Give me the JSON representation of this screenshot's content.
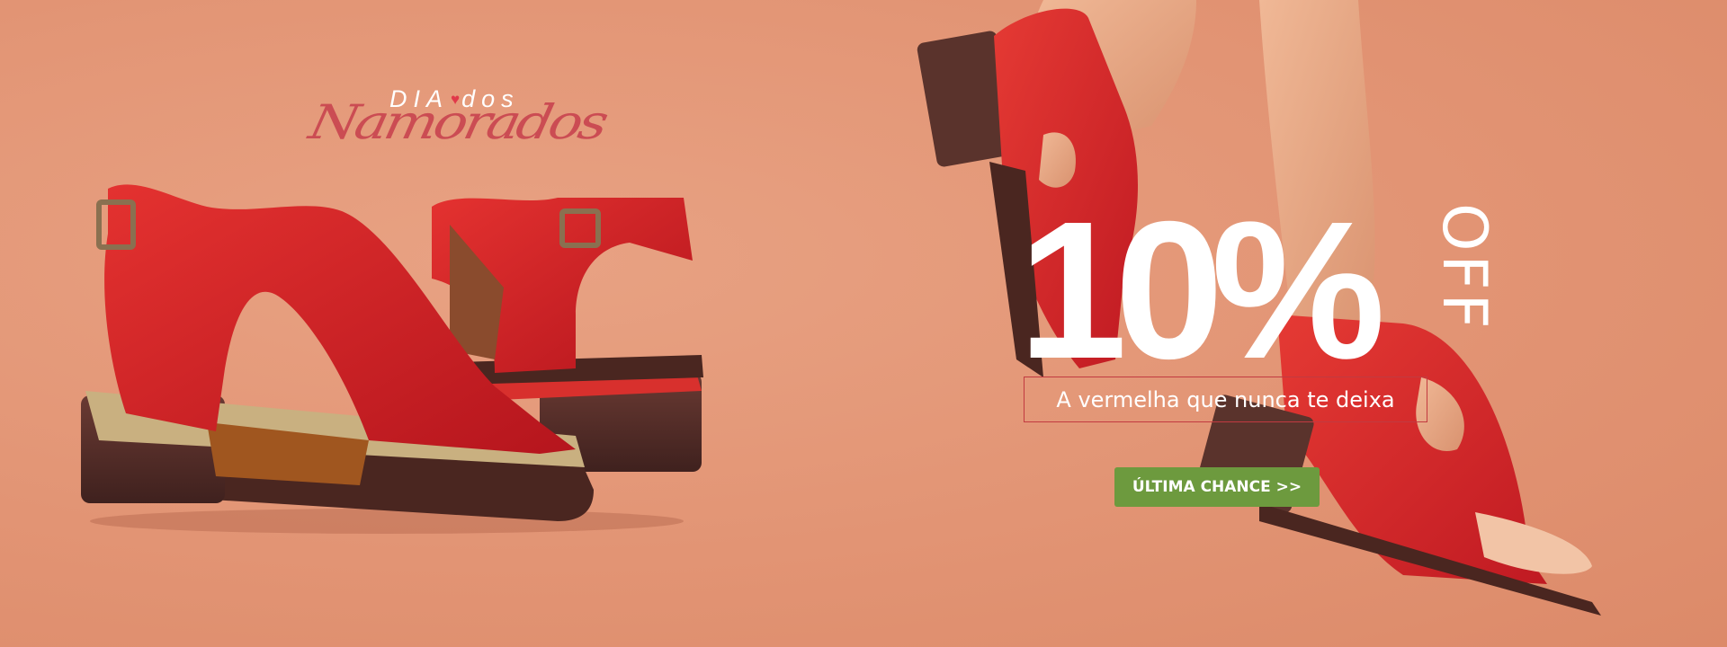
{
  "banner": {
    "logo": {
      "top_text_left": "DIA",
      "top_text_right": "dos",
      "script_text": "Namorados"
    },
    "promo": {
      "discount": "10%",
      "off_label": "OFF",
      "tagline": "A vermelha que nunca te deixa",
      "cta_label": "ÚLTIMA CHANCE >>"
    },
    "colors": {
      "background": "#e29474",
      "product_red": "#d8202a",
      "cta_green": "#6d9a3e",
      "tagline_border": "#c23a40",
      "text": "#ffffff"
    },
    "icons": [
      "heart-icon"
    ]
  }
}
